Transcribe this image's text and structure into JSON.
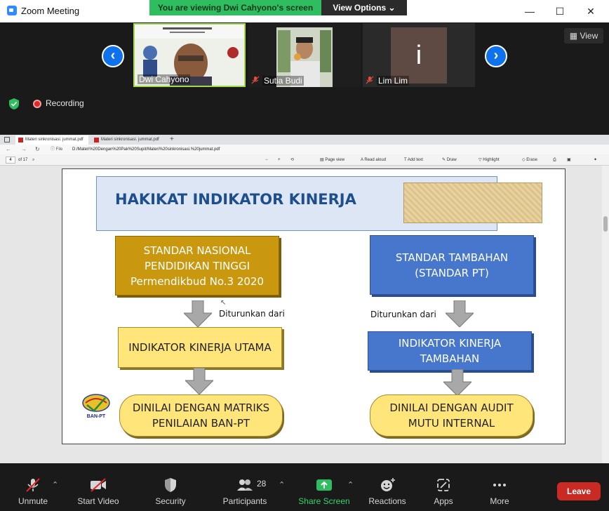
{
  "window": {
    "title": "Zoom Meeting"
  },
  "banner": {
    "viewing_text": "You are viewing Dwi Cahyono's screen",
    "view_options_label": "View Options"
  },
  "participants_strip": {
    "tiles": [
      {
        "name": "Dwi Cahyono",
        "muted": false,
        "active_speaker": true
      },
      {
        "name": "Sutia Budi",
        "muted": true
      },
      {
        "name": "Lim Lim",
        "muted": true,
        "initial": "i"
      }
    ],
    "view_label": "View"
  },
  "recording": {
    "label": "Recording"
  },
  "browser": {
    "tabs": [
      {
        "label": "Materi sinkronisasi. jummat.pdf"
      },
      {
        "label": "Materi sinkronisasi. jummat.pdf"
      }
    ],
    "file_label": "File",
    "url": "D:/Materi%20Dengan%20Pak%20Supit/Materi%20sinkronisasi.%20jummat.pdf",
    "page_current": "4",
    "page_total": "of 17",
    "tools": {
      "page_view": "Page view",
      "read_aloud": "Read aloud",
      "add_text": "Add text",
      "draw": "Draw",
      "highlight": "Highlight",
      "erase": "Erase"
    }
  },
  "slide": {
    "title": "HAKIKAT INDIKATOR KINERJA",
    "snpt_lines": [
      "STANDAR NASIONAL",
      "PENDIDIKAN TINGGI",
      "Permendikbud No.3 2020"
    ],
    "spt_lines": [
      "STANDAR TAMBAHAN",
      "(STANDAR PT)"
    ],
    "derived_left": "Diturunkan dari",
    "derived_right": "Diturunkan dari",
    "iku": "INDIKATOR KINERJA UTAMA",
    "ikt_lines": [
      "INDIKATOR KINERJA",
      "TAMBAHAN"
    ],
    "matriks_lines": [
      "DINILAI DENGAN MATRIKS",
      "PENILAIAN BAN-PT"
    ],
    "audit_lines": [
      "DINILAI DENGAN AUDIT",
      "MUTU INTERNAL"
    ],
    "logo_text": "BAN-PT"
  },
  "toolbar": {
    "unmute": "Unmute",
    "start_video": "Start Video",
    "security": "Security",
    "participants": "Participants",
    "participant_count": "28",
    "share_screen": "Share Screen",
    "reactions": "Reactions",
    "apps": "Apps",
    "more": "More",
    "leave": "Leave"
  },
  "colors": {
    "accent_blue": "#0e72ed",
    "banner_green": "#2fbe5f",
    "leave_red": "#c92b24",
    "slide_gold": "#c9980f",
    "slide_blue": "#4677cc",
    "slide_yellow": "#ffe57a"
  }
}
